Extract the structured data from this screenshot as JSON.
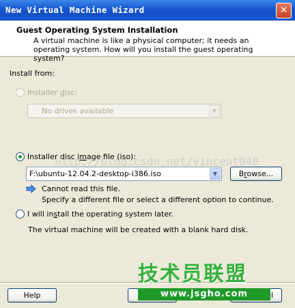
{
  "window": {
    "title": "New Virtual Machine Wizard",
    "close_symbol": "✕"
  },
  "header": {
    "title": "Guest Operating System Installation",
    "description": "A virtual machine is like a physical computer; it needs an operating system. How will you install the guest operating system?"
  },
  "install_from": {
    "label": "Install from:"
  },
  "installer_disc": {
    "label_pre": "Installer ",
    "label_key": "d",
    "label_post": "isc:",
    "selected": false,
    "enabled": false,
    "dropdown_value": "No drives available"
  },
  "iso_option": {
    "label_pre": "Installer disc i",
    "label_key": "m",
    "label_post": "age file (iso):",
    "selected": true,
    "value": "F:\\ubuntu-12.04.2-desktop-i386.iso",
    "browse_label_pre": "B",
    "browse_label_key": "r",
    "browse_label_post": "owse...",
    "message_line1": "Cannot read this file.",
    "message_line2": "Specify a different file or select a different option to continue."
  },
  "later_option": {
    "label_pre": "I will in",
    "label_key": "s",
    "label_post": "tall the operating system later.",
    "selected": false,
    "description": "The virtual machine will be created with a blank hard disk."
  },
  "watermark": "http://blog.csdn.net/vincent040",
  "footer": {
    "help_label": "Help",
    "cancel_label_tail": "cel"
  },
  "logo": {
    "text_top": "技术员联盟",
    "text_bottom": "www.jsgho.com"
  },
  "colors": {
    "titlebar": "#1957d2",
    "dialog_bg": "#ece9d8",
    "radio_dot": "#21a121",
    "logo_green": "#1f9a2a"
  }
}
